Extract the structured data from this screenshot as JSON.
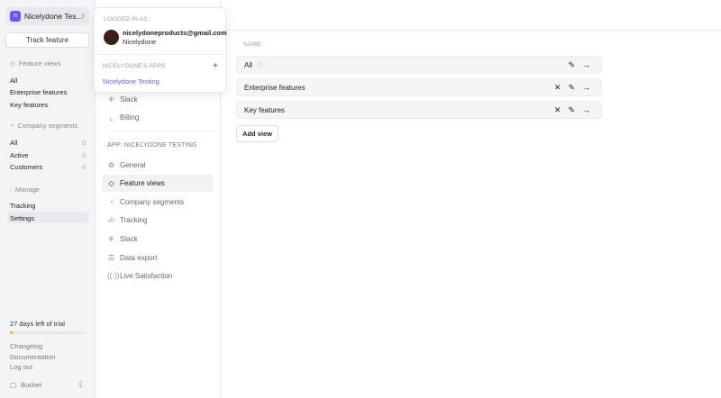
{
  "app": {
    "name": "Nicelydone Tes...",
    "initial": "N"
  },
  "sidebar": {
    "track_feature": "Track feature",
    "feature_views": {
      "title": "Feature views",
      "items": [
        "All",
        "Enterprise features",
        "Key features"
      ]
    },
    "company_segments": {
      "title": "Company segments",
      "items": [
        {
          "label": "All",
          "count": "0"
        },
        {
          "label": "Active",
          "count": "0"
        },
        {
          "label": "Customers",
          "count": "0"
        }
      ]
    },
    "manage": {
      "title": "Manage",
      "items": [
        "Tracking",
        "Settings"
      ],
      "selected": "Settings"
    },
    "trial": {
      "text": "27 days left of trial",
      "progress_percent": 4,
      "color": "#f3b400"
    },
    "links": [
      "Changelog",
      "Documentation",
      "Log out"
    ],
    "brand": "Bucket"
  },
  "settings_nav": {
    "top_items": [
      {
        "label": "Slack",
        "icon": "slack-icon"
      },
      {
        "label": "Billing",
        "icon": "chart-icon"
      }
    ],
    "section": "APP: NICELYDONE TESTING",
    "items": [
      {
        "label": "General",
        "icon": "gear-icon"
      },
      {
        "label": "Feature views",
        "icon": "eye-icon",
        "active": true
      },
      {
        "label": "Company segments",
        "icon": "pie-icon"
      },
      {
        "label": "Tracking",
        "icon": "code-icon"
      },
      {
        "label": "Slack",
        "icon": "slack-icon"
      },
      {
        "label": "Data export",
        "icon": "database-icon"
      },
      {
        "label": "Live Satisfaction",
        "icon": "broadcast-icon"
      }
    ]
  },
  "main": {
    "column": "NAME",
    "rows": [
      {
        "name": "All",
        "deletable": false
      },
      {
        "name": "Enterprise features",
        "deletable": true
      },
      {
        "name": "Key features",
        "deletable": true
      }
    ],
    "add_view": "Add view"
  },
  "popup": {
    "logged_in_as": "LOGGED IN AS",
    "email": "nicelydoneproducts@gmail.com",
    "name": "Nicelydone",
    "apps_label": "NICELYDONE'S APPS",
    "apps": [
      "Nicelydone Testing"
    ]
  },
  "colors": {
    "accent": "#655bf0"
  }
}
